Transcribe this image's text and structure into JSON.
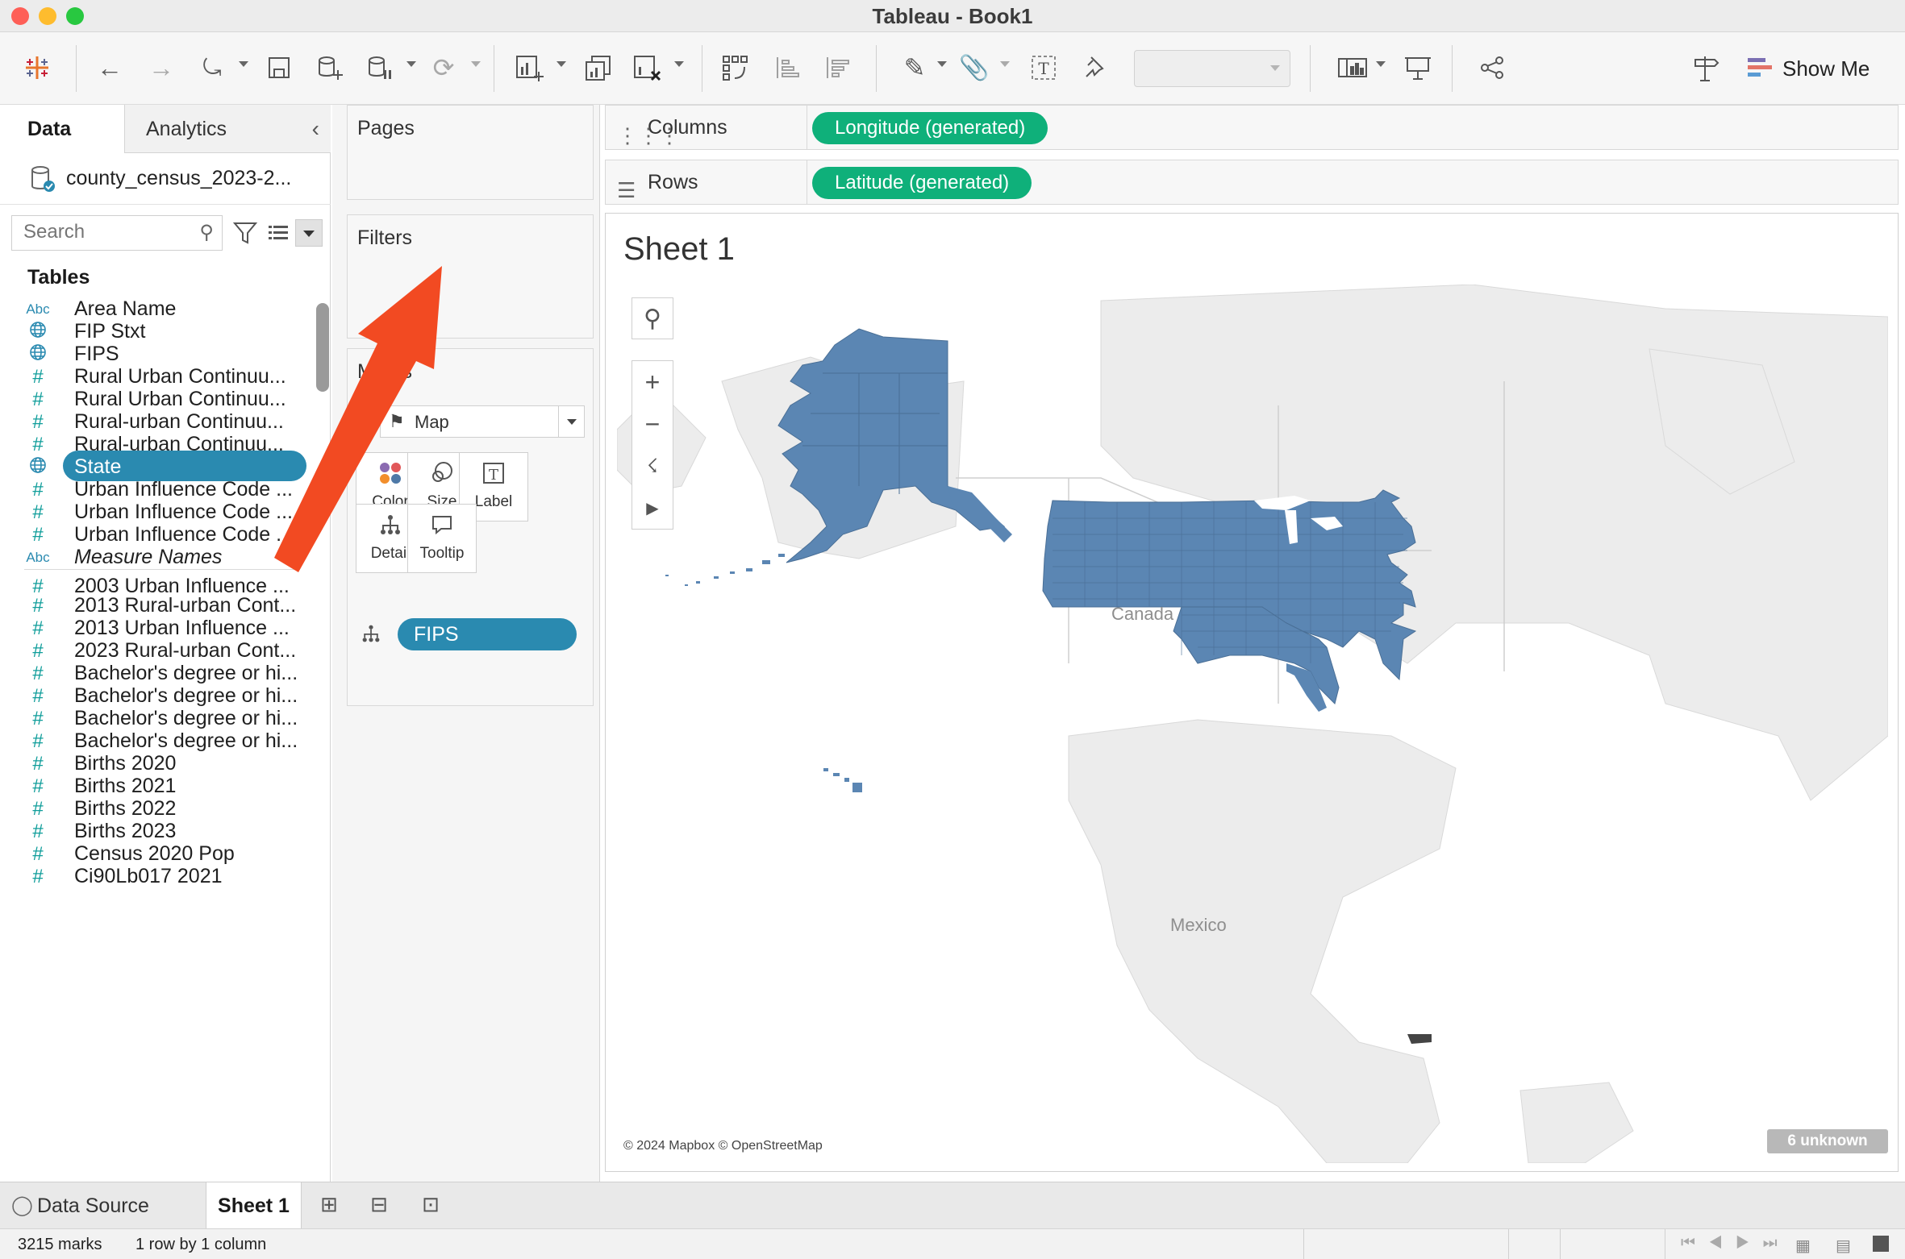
{
  "window": {
    "title": "Tableau - Book1"
  },
  "toolbar": {
    "show_me_label": "Show Me"
  },
  "data_pane": {
    "tabs": [
      "Data",
      "Analytics"
    ],
    "data_source": "county_census_2023-2...",
    "search_placeholder": "Search",
    "tables_label": "Tables",
    "fields": [
      {
        "type": "abc",
        "name": "Area Name"
      },
      {
        "type": "geo",
        "name": "FIP Stxt"
      },
      {
        "type": "geo-key",
        "name": "FIPS"
      },
      {
        "type": "num",
        "name": "Rural Urban Continuu..."
      },
      {
        "type": "num",
        "name": "Rural Urban Continuu..."
      },
      {
        "type": "num",
        "name": "Rural-urban Continuu..."
      },
      {
        "type": "num",
        "name": "Rural-urban Continuu..."
      },
      {
        "type": "geo",
        "name": "State",
        "selected": true
      },
      {
        "type": "num",
        "name": "Urban Influence Code ..."
      },
      {
        "type": "num",
        "name": "Urban Influence Code ..."
      },
      {
        "type": "num",
        "name": "Urban Influence Code ..."
      },
      {
        "type": "abc",
        "name": "Measure Names",
        "italic": true
      },
      {
        "type": "num",
        "name": "2003 Urban Influence ..."
      },
      {
        "type": "num",
        "name": "2013 Rural-urban Cont..."
      },
      {
        "type": "num",
        "name": "2013 Urban Influence ..."
      },
      {
        "type": "num",
        "name": "2023 Rural-urban Cont..."
      },
      {
        "type": "num",
        "name": "Bachelor's degree or hi..."
      },
      {
        "type": "num",
        "name": "Bachelor's degree or hi..."
      },
      {
        "type": "num",
        "name": "Bachelor's degree or hi..."
      },
      {
        "type": "num",
        "name": "Bachelor's degree or hi..."
      },
      {
        "type": "num",
        "name": "Births 2020"
      },
      {
        "type": "num",
        "name": "Births 2021"
      },
      {
        "type": "num",
        "name": "Births 2022"
      },
      {
        "type": "num",
        "name": "Births 2023"
      },
      {
        "type": "num",
        "name": "Census 2020 Pop"
      },
      {
        "type": "num",
        "name": "Ci90Lb017 2021"
      }
    ]
  },
  "cards": {
    "pages": "Pages",
    "filters": "Filters",
    "marks": "Marks",
    "marks_type": "Map",
    "mark_buttons": [
      "Color",
      "Size",
      "Label",
      "Detail",
      "Tooltip"
    ],
    "marks_pill": "FIPS"
  },
  "shelves": {
    "columns_label": "Columns",
    "columns_pill": "Longitude (generated)",
    "rows_label": "Rows",
    "rows_pill": "Latitude (generated)"
  },
  "sheet": {
    "title": "Sheet 1",
    "map_labels": {
      "canada": "Canada",
      "mexico": "Mexico"
    },
    "attribution": "© 2024 Mapbox © OpenStreetMap",
    "unknown_badge": "6 unknown"
  },
  "tabs_bar": {
    "data_source": "Data Source",
    "sheet": "Sheet 1"
  },
  "status": {
    "marks": "3215 marks",
    "layout": "1 row by 1 column"
  },
  "colors": {
    "map_fill": "#5b86b3",
    "pill_green": "#0fb07a",
    "pill_blue": "#2a8ab0",
    "arrow": "#f24a22"
  }
}
